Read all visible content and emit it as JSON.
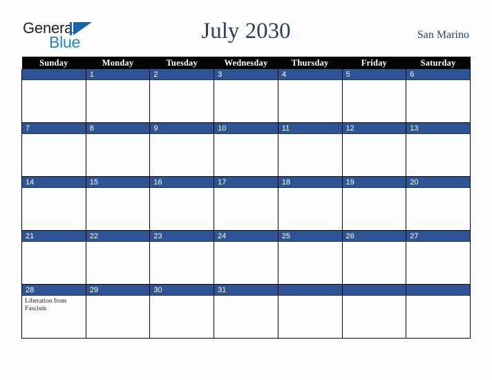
{
  "brand": {
    "word_one": "General",
    "word_two": "Blue",
    "mark_icon": "triangle-flag-icon",
    "color_dark": "#231f20",
    "color_blue": "#1a86d0",
    "color_mark": "#1565a8"
  },
  "header": {
    "title": "July 2030",
    "location": "San Marino",
    "title_color": "#2a3f66"
  },
  "theme": {
    "header_bar_bg": "#050505",
    "day_band_bg": "#2f5496",
    "cell_bg": "#fdfdfd",
    "page_bg": "#fdfdfd",
    "grid_line": "#000000"
  },
  "weekdays": [
    "Sunday",
    "Monday",
    "Tuesday",
    "Wednesday",
    "Thursday",
    "Friday",
    "Saturday"
  ],
  "weeks": [
    [
      {
        "day": "",
        "events": []
      },
      {
        "day": "1",
        "events": []
      },
      {
        "day": "2",
        "events": []
      },
      {
        "day": "3",
        "events": []
      },
      {
        "day": "4",
        "events": []
      },
      {
        "day": "5",
        "events": []
      },
      {
        "day": "6",
        "events": []
      }
    ],
    [
      {
        "day": "7",
        "events": []
      },
      {
        "day": "8",
        "events": []
      },
      {
        "day": "9",
        "events": []
      },
      {
        "day": "10",
        "events": []
      },
      {
        "day": "11",
        "events": []
      },
      {
        "day": "12",
        "events": []
      },
      {
        "day": "13",
        "events": []
      }
    ],
    [
      {
        "day": "14",
        "events": []
      },
      {
        "day": "15",
        "events": []
      },
      {
        "day": "16",
        "events": []
      },
      {
        "day": "17",
        "events": []
      },
      {
        "day": "18",
        "events": []
      },
      {
        "day": "19",
        "events": []
      },
      {
        "day": "20",
        "events": []
      }
    ],
    [
      {
        "day": "21",
        "events": []
      },
      {
        "day": "22",
        "events": []
      },
      {
        "day": "23",
        "events": []
      },
      {
        "day": "24",
        "events": []
      },
      {
        "day": "25",
        "events": []
      },
      {
        "day": "26",
        "events": []
      },
      {
        "day": "27",
        "events": []
      }
    ],
    [
      {
        "day": "28",
        "events": [
          "Liberation from Fascism"
        ]
      },
      {
        "day": "29",
        "events": []
      },
      {
        "day": "30",
        "events": []
      },
      {
        "day": "31",
        "events": []
      },
      {
        "day": "",
        "events": []
      },
      {
        "day": "",
        "events": []
      },
      {
        "day": "",
        "events": []
      }
    ]
  ]
}
